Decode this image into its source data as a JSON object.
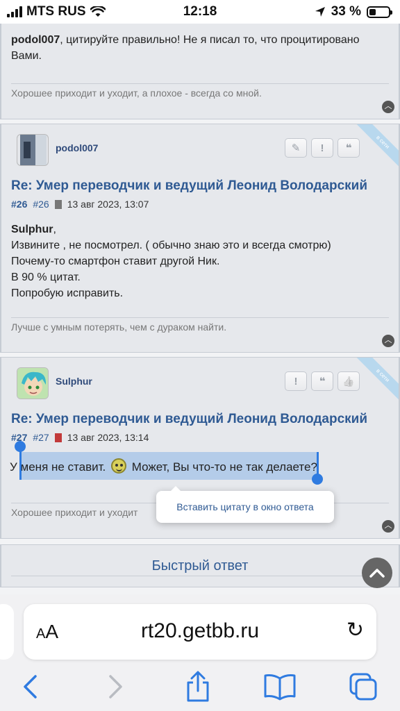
{
  "status": {
    "carrier": "MTS RUS",
    "time": "12:18",
    "battery_text": "33 %",
    "battery_level": 0.33
  },
  "post_prev": {
    "author_mention": "podol007",
    "text_rest": ", цитируйте правильно! Не я писал то, что процитировано",
    "text_line2": "Вами.",
    "signature": "Хорошее приходит и уходит, а плохое - всегда со мной."
  },
  "post26": {
    "username": "podol007",
    "online_badge": "в сети",
    "title": "Re: Умер переводчик и ведущий Леонид Володарский",
    "post_num_bold": "#26",
    "post_num_link": "#26",
    "date": "13 авг 2023, 13:07",
    "mention": "Sulphur",
    "mention_suffix": ",",
    "lines": [
      "Извините , не посмотрел. ( обычно знаю это и всегда смотрю)",
      "Почему-то смартфон ставит другой Ник.",
      "В 90 % цитат.",
      "Попробую исправить."
    ],
    "signature": "Лучше с умным потерять, чем с дураком найти.",
    "btn_edit": "✎",
    "btn_report": "!",
    "btn_quote": "❝"
  },
  "post27": {
    "username": "Sulphur",
    "online_badge": "в сети",
    "title": "Re: Умер переводчик и ведущий Леонид Володарский",
    "post_num_bold": "#27",
    "post_num_link": "#27",
    "date": "13 авг 2023, 13:14",
    "text_a": "У",
    "text_b": " меня не ставит. ",
    "text_c": " Может, Вы что-то не так делаете?",
    "signature": "Хорошее приходит и уходит",
    "btn_report": "!",
    "btn_quote": "❝",
    "btn_like": "👍"
  },
  "popup": {
    "label": "Вставить цитату в окно ответа"
  },
  "quick_reply": {
    "label": "Быстрый ответ"
  },
  "safari": {
    "aa_small": "A",
    "aa_big": "A",
    "url": "rt20.getbb.ru",
    "reload_glyph": "↻"
  }
}
